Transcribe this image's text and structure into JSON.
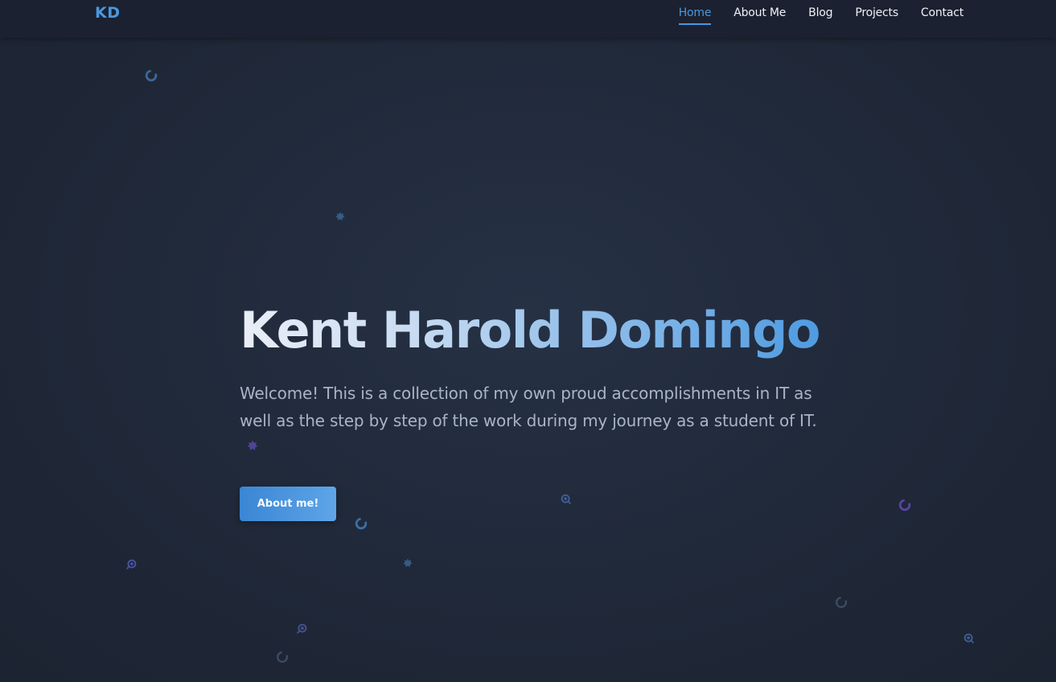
{
  "navbar": {
    "logo": "KD",
    "links": [
      {
        "label": "Home",
        "active": true
      },
      {
        "label": "About Me",
        "active": false
      },
      {
        "label": "Blog",
        "active": false
      },
      {
        "label": "Projects",
        "active": false
      },
      {
        "label": "Contact",
        "active": false
      }
    ]
  },
  "hero": {
    "title": "Kent Harold Domingo",
    "description": "Welcome! This is a collection of my own proud accomplishments in IT as well as the step by step of the work during my journey as a student of IT.",
    "button_label": "About me!"
  },
  "theme": {
    "accent": "#4a98e0",
    "background": "#212a3b",
    "navbar_background": "#1b2130",
    "text": "#a9b4c5"
  },
  "particles": [
    {
      "icon": "ring-icon",
      "color": "#4a7fb8"
    },
    {
      "icon": "gear-icon",
      "color": "#3c6e9e"
    },
    {
      "icon": "user-pin-icon",
      "color": "#4a74b8"
    },
    {
      "icon": "ring-icon",
      "color": "#4a86c8"
    },
    {
      "icon": "user-pin-icon",
      "color": "#5a63c9"
    },
    {
      "icon": "gear-icon",
      "color": "#3c6e9e"
    },
    {
      "icon": "user-pin-icon",
      "color": "#5561b5"
    },
    {
      "icon": "ring-icon",
      "color": "#6b4fc8"
    },
    {
      "icon": "ring-icon",
      "color": "#4a5a72"
    },
    {
      "icon": "user-pin-icon",
      "color": "#4a74b8"
    },
    {
      "icon": "ring-icon",
      "color": "#4a5a72"
    },
    {
      "icon": "gear-icon",
      "color": "#6a5ad0"
    }
  ]
}
